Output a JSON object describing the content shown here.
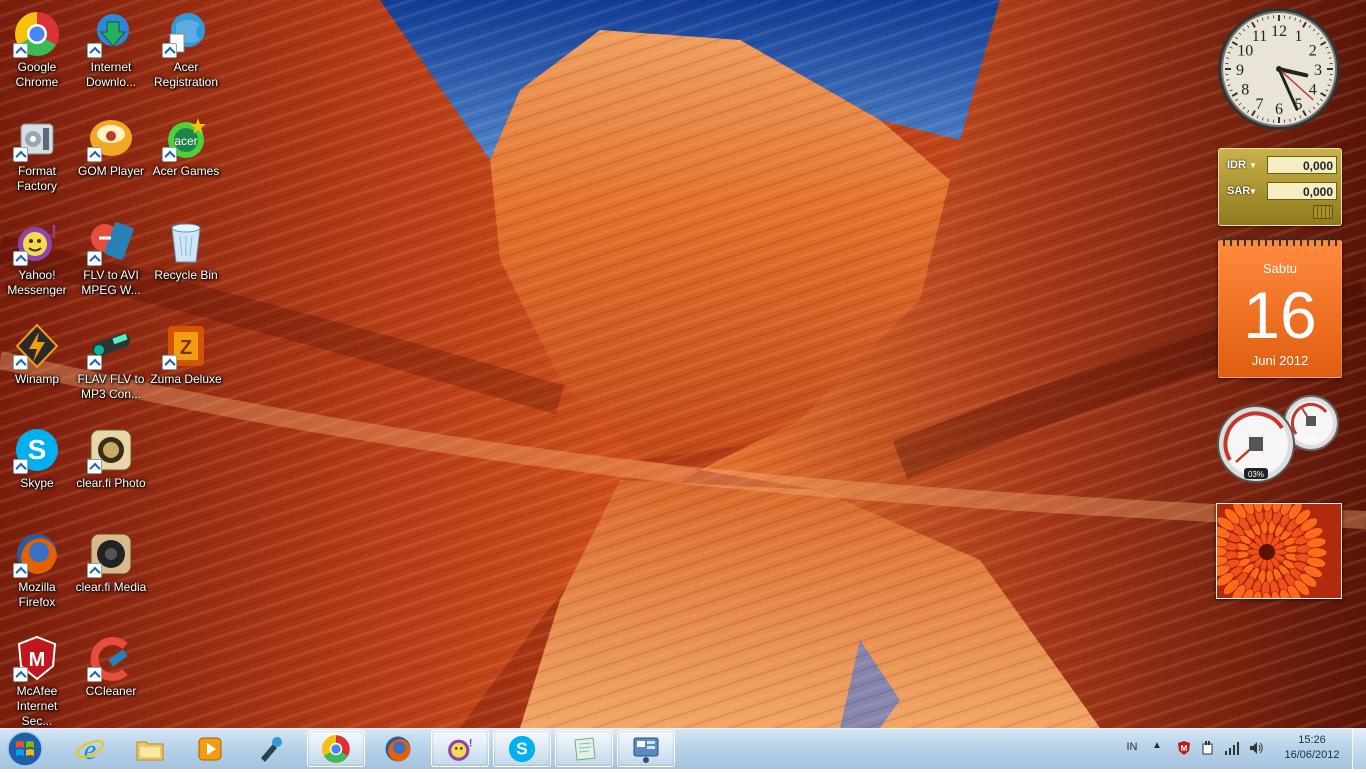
{
  "desktop": {
    "icons": [
      {
        "label": "Google\nChrome",
        "icon": "chrome-icon"
      },
      {
        "label": "Internet\nDownlo...",
        "icon": "idm-icon"
      },
      {
        "label": "Acer\nRegistration",
        "icon": "acer-registration-icon"
      },
      {
        "label": "Format\nFactory",
        "icon": "format-factory-icon"
      },
      {
        "label": "GOM Player",
        "icon": "gom-player-icon"
      },
      {
        "label": "Acer Games",
        "icon": "acer-games-icon"
      },
      {
        "label": "Yahoo!\nMessenger",
        "icon": "yahoo-messenger-icon"
      },
      {
        "label": "FLV to AVI\nMPEG W...",
        "icon": "flv-to-avi-icon"
      },
      {
        "label": "Recycle Bin",
        "icon": "recycle-bin-icon"
      },
      {
        "label": "Winamp",
        "icon": "winamp-icon"
      },
      {
        "label": "FLAV FLV to\nMP3 Con...",
        "icon": "flv-to-mp3-icon"
      },
      {
        "label": "Zuma Deluxe",
        "icon": "zuma-deluxe-icon"
      },
      {
        "label": "Skype",
        "icon": "skype-icon"
      },
      {
        "label": "clear.fi Photo",
        "icon": "clearfi-photo-icon"
      },
      {
        "label": "Mozilla\nFirefox",
        "icon": "firefox-icon"
      },
      {
        "label": "clear.fi Media",
        "icon": "clearfi-media-icon"
      },
      {
        "label": "McAfee\nInternet Sec...",
        "icon": "mcafee-icon"
      },
      {
        "label": "CCleaner",
        "icon": "ccleaner-icon"
      }
    ]
  },
  "gadgets": {
    "clock": {
      "hour": 3,
      "minute": 26,
      "second": 22,
      "numerals": [
        "12",
        "1",
        "2",
        "3",
        "4",
        "5",
        "6",
        "7",
        "8",
        "9",
        "10",
        "11"
      ]
    },
    "currency": {
      "rows": [
        {
          "code": "IDR",
          "value": "0,000"
        },
        {
          "code": "SAR",
          "value": "0,000"
        }
      ]
    },
    "calendar": {
      "day": "Sabtu",
      "date": "16",
      "month": "Juni 2012"
    },
    "meter": {
      "cpu": "03%",
      "memory": "44%"
    },
    "slideshow": {
      "subject": "orange-chrysanthemum-photo"
    }
  },
  "taskbar": {
    "items": [
      {
        "name": "internet-explorer",
        "icon": "ie-icon"
      },
      {
        "name": "windows-explorer",
        "icon": "folder-icon"
      },
      {
        "name": "media-player",
        "icon": "media-player-icon"
      },
      {
        "name": "tool",
        "icon": "tool-icon"
      },
      {
        "name": "google-chrome",
        "icon": "chrome-icon"
      },
      {
        "name": "mozilla-firefox",
        "icon": "firefox-icon"
      },
      {
        "name": "yahoo-messenger",
        "icon": "yahoo-messenger-icon"
      },
      {
        "name": "skype",
        "icon": "skype-icon"
      },
      {
        "name": "notes",
        "icon": "notes-icon"
      },
      {
        "name": "control-panel",
        "icon": "control-panel-icon"
      }
    ],
    "tray": {
      "language": "IN",
      "show_hidden": "▲",
      "time": "15:26",
      "date": "16/06/2012"
    }
  },
  "colors": {
    "taskbar": "#b4d0e8",
    "calendar": "#f07a2a",
    "currency": "#b9a23c",
    "sky": "#1b4fa8"
  }
}
